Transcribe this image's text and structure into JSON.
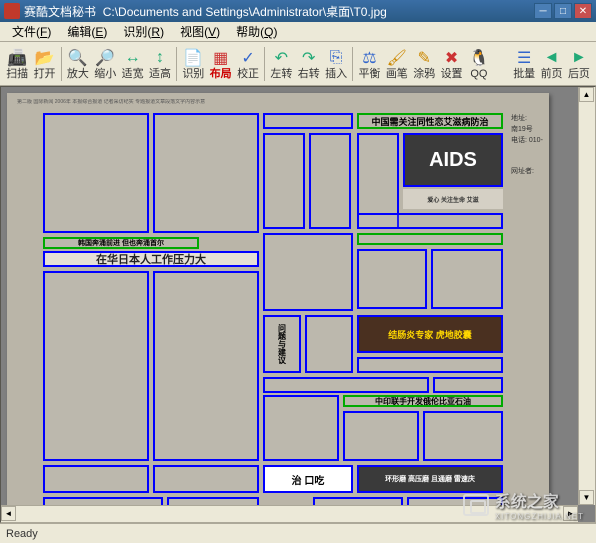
{
  "titlebar": {
    "app_name": "赛酷文档秘书",
    "file_path": "C:\\Documents and Settings\\Administrator\\桌面\\T0.jpg"
  },
  "menus": [
    {
      "label": "文件",
      "key": "F"
    },
    {
      "label": "编辑",
      "key": "E"
    },
    {
      "label": "识别",
      "key": "R"
    },
    {
      "label": "视图",
      "key": "V"
    },
    {
      "label": "帮助",
      "key": "Q"
    }
  ],
  "toolbar": {
    "scan": "扫描",
    "open": "打开",
    "zoom_in": "放大",
    "zoom_out": "缩小",
    "fit_width": "适宽",
    "fit_height": "适高",
    "recognize": "识别",
    "layout": "布局",
    "correct": "校正",
    "rotate_left": "左转",
    "rotate_right": "右转",
    "insert": "插入",
    "balance": "平衡",
    "brush": "画笔",
    "pen": "涂鸦",
    "settings": "设置",
    "qq": "QQ",
    "batch": "批量",
    "prev": "前页",
    "next": "后页"
  },
  "document": {
    "headlines": {
      "h1": "中国需关注同性恋艾滋病防治",
      "h2": "在华日本人工作压力大",
      "h3": "中印联手开发俄伦比亚石油",
      "sub1": "韩国奔涌前进 但也奔涌首尔"
    },
    "ads": {
      "aids": "AIDS",
      "aids_sub": "爱心 关注生命\n艾滋",
      "colitis": "结肠炎专家\n虎地胶囊",
      "kouchi": "治 口吃",
      "issue": "问题与建议",
      "ring": "环形磨 高压磨\n且通磨 雷速庆"
    },
    "sidebar": {
      "addr_label": "地址:",
      "tel_label": "电话: 010-",
      "addr2": "南19号",
      "net": "网址者:"
    }
  },
  "statusbar": {
    "text": "Ready"
  },
  "watermark": {
    "text": "系统之家",
    "url": "XITONGZHIJIA.NET"
  }
}
